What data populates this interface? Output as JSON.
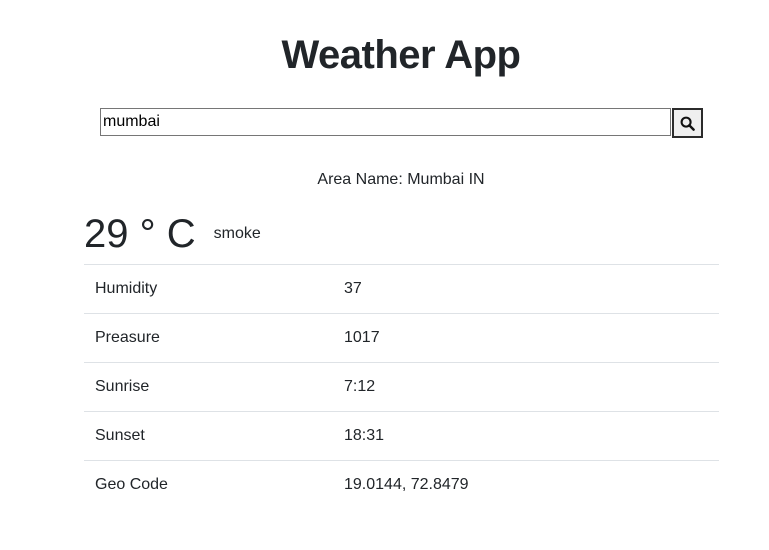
{
  "app": {
    "title": "Weather App"
  },
  "search": {
    "value": "mumbai",
    "button_icon": "search-icon"
  },
  "location": {
    "area_name": "Area Name: Mumbai IN"
  },
  "current": {
    "temperature": "29 ° C",
    "condition": "smoke"
  },
  "details": [
    {
      "label": "Humidity",
      "value": "37"
    },
    {
      "label": "Preasure",
      "value": "1017"
    },
    {
      "label": "Sunrise",
      "value": "7:12"
    },
    {
      "label": "Sunset",
      "value": "18:31"
    },
    {
      "label": "Geo Code",
      "value": "19.0144, 72.8479"
    }
  ]
}
